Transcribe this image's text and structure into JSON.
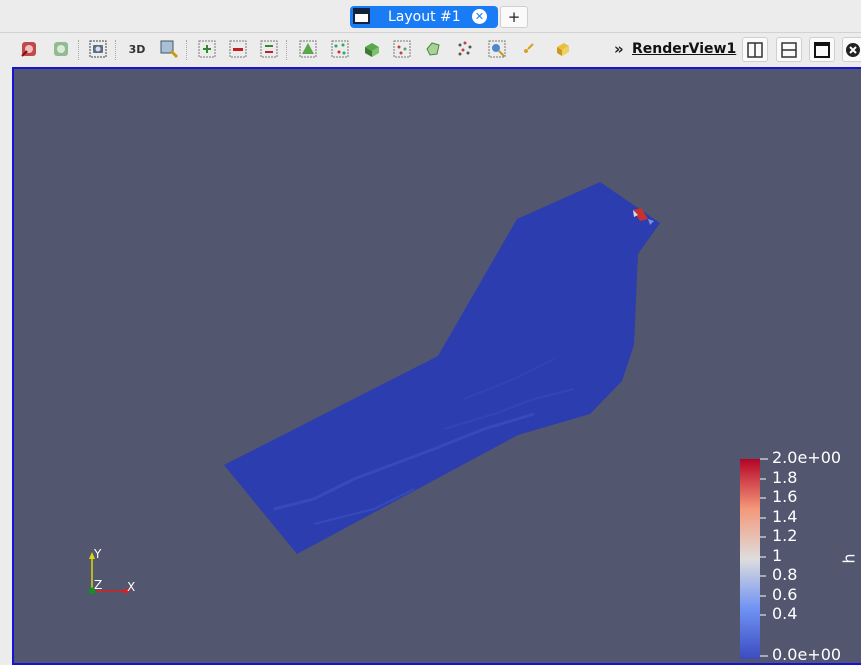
{
  "tabs": {
    "active_label": "Layout #1",
    "add_label": "+"
  },
  "toolbar": {
    "label_3d": "3D",
    "more_glyph": "»",
    "render_view_label": "RenderView1",
    "buttons": [
      "reset-camera-icon",
      "reset-camera-closest-icon",
      "capture-screenshot-icon",
      "toggle-3d-icon",
      "zoom-to-box-icon",
      "zoom-in-icon",
      "zoom-out-icon",
      "zoom-closest-icon",
      "select-surface-cells-icon",
      "select-surface-points-icon",
      "select-frustum-cells-icon",
      "select-frustum-points-icon",
      "select-polygon-cells-icon",
      "select-polygon-points-icon",
      "interactive-select-icon",
      "hover-points-icon",
      "grow-selection-icon",
      "split-horizontal-icon",
      "split-vertical-icon",
      "maximize-icon",
      "close-view-icon"
    ]
  },
  "colorbar": {
    "title": "h",
    "min": 0.0,
    "max": 2.0,
    "tick_labels": [
      "2.0e+00",
      "1.8",
      "1.6",
      "1.4",
      "1.2",
      "1",
      "0.8",
      "0.6",
      "0.4",
      "0.0e+00"
    ],
    "colors": {
      "low": "#3b4cc0",
      "mid": "#dddddd",
      "high": "#b40426"
    }
  },
  "axes": {
    "x": "X",
    "y": "Y",
    "z": "Z"
  },
  "colors": {
    "viewport_background": "#52566f",
    "mesh_fill": "#2c3db0",
    "active_tab": "#1a7cf5",
    "view_border": "#1414d6"
  }
}
